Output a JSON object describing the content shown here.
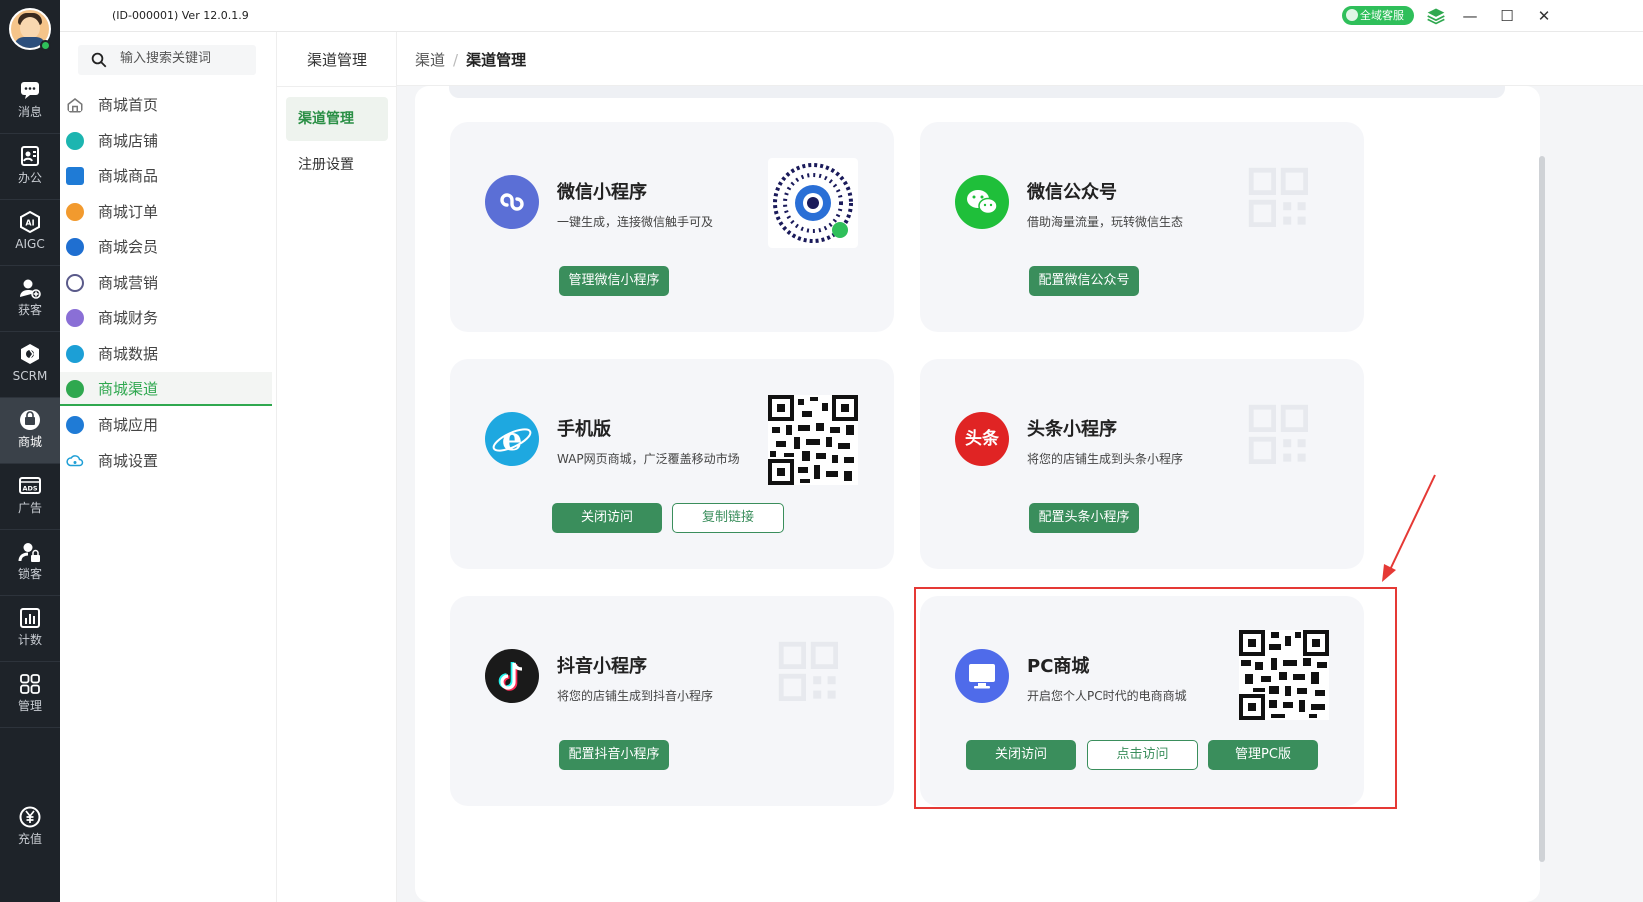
{
  "app": {
    "version": "(ID-000001)  Ver 12.0.1.9",
    "service_badge": "全域客服"
  },
  "rail": {
    "items": [
      {
        "label": "消息",
        "icon": "message-icon"
      },
      {
        "label": "办公",
        "icon": "office-icon"
      },
      {
        "label": "AIGC",
        "icon": "aigc-icon"
      },
      {
        "label": "获客",
        "icon": "acquire-customer-icon"
      },
      {
        "label": "SCRM",
        "icon": "scrm-icon"
      },
      {
        "label": "商城",
        "icon": "mall-icon"
      },
      {
        "label": "广告",
        "icon": "ads-icon"
      },
      {
        "label": "锁客",
        "icon": "lock-customer-icon"
      },
      {
        "label": "计数",
        "icon": "stats-icon"
      },
      {
        "label": "管理",
        "icon": "grid-icon"
      }
    ],
    "recharge_label": "充值",
    "active": "商城"
  },
  "menu": {
    "search_placeholder": "输入搜索关键词",
    "items": [
      {
        "label": "商城首页",
        "color": "#777777"
      },
      {
        "label": "商城店铺",
        "color": "#1cb5b0"
      },
      {
        "label": "商城商品",
        "color": "#1f7bd6"
      },
      {
        "label": "商城订单",
        "color": "#f29a2e"
      },
      {
        "label": "商城会员",
        "color": "#1f6fd1"
      },
      {
        "label": "商城营销",
        "color": "#5a5a8a"
      },
      {
        "label": "商城财务",
        "color": "#8a6fd6"
      },
      {
        "label": "商城数据",
        "color": "#1c9fd6"
      },
      {
        "label": "商城渠道",
        "color": "#2fa84f"
      },
      {
        "label": "商城应用",
        "color": "#1f7bd6"
      },
      {
        "label": "商城设置",
        "color": "#1f9fd6"
      }
    ],
    "active": "商城渠道"
  },
  "sub": {
    "title": "渠道管理",
    "items": [
      {
        "label": "渠道管理"
      },
      {
        "label": "注册设置"
      }
    ],
    "active": "渠道管理"
  },
  "breadcrumb": {
    "parent": "渠道",
    "sep": "/",
    "current": "渠道管理"
  },
  "cards": [
    {
      "title": "微信小程序",
      "desc": "一键生成，连接微信触手可及",
      "logo_color": "#5b6fd6",
      "logo": "link-icon",
      "qr": "wechat-miniprogram-code",
      "buttons": [
        {
          "label": "管理微信小程序",
          "style": "solid"
        }
      ]
    },
    {
      "title": "微信公众号",
      "desc": "借助海量流量，玩转微信生态",
      "logo_color": "#1fbf3a",
      "logo": "wechat-icon",
      "qr": "placeholder",
      "buttons": [
        {
          "label": "配置微信公众号",
          "style": "solid"
        }
      ]
    },
    {
      "title": "手机版",
      "desc": "WAP网页商城，广泛覆盖移动市场",
      "logo_color": "#1ea8e0",
      "logo": "ie-icon",
      "qr": "qr-code",
      "buttons": [
        {
          "label": "关闭访问",
          "style": "solid"
        },
        {
          "label": "复制链接",
          "style": "outline"
        }
      ]
    },
    {
      "title": "头条小程序",
      "desc": "将您的店铺生成到头条小程序",
      "logo_color": "#e02424",
      "logo": "toutiao-icon",
      "logo_text": "头条",
      "qr": "placeholder",
      "buttons": [
        {
          "label": "配置头条小程序",
          "style": "solid"
        }
      ]
    },
    {
      "title": "抖音小程序",
      "desc": "将您的店铺生成到抖音小程序",
      "logo_color": "#1a1a1a",
      "logo": "tiktok-icon",
      "qr": "placeholder",
      "buttons": [
        {
          "label": "配置抖音小程序",
          "style": "solid"
        }
      ]
    },
    {
      "title": "PC商城",
      "desc": "开启您个人PC时代的电商商城",
      "logo_color": "#4f6bea",
      "logo": "monitor-icon",
      "qr": "qr-code",
      "buttons": [
        {
          "label": "关闭访问",
          "style": "solid"
        },
        {
          "label": "点击访问",
          "style": "outline"
        },
        {
          "label": "管理PC版",
          "style": "solid"
        }
      ]
    }
  ]
}
